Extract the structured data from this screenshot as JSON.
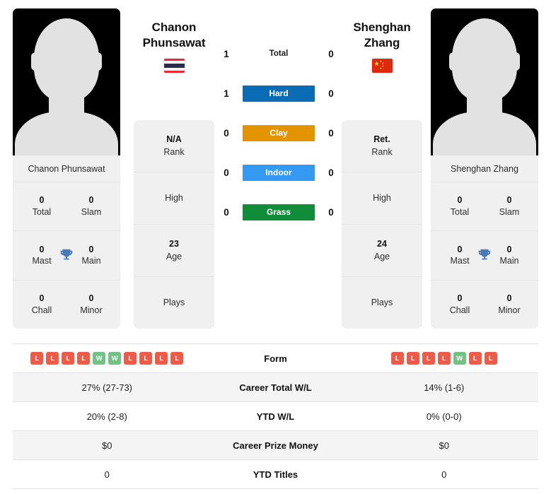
{
  "players": {
    "left": {
      "name_line1": "Chanon",
      "name_line2": "Phunsawat",
      "full_name": "Chanon Phunsawat",
      "flag": "thailand-flag",
      "rank_value": "N/A",
      "rank_label": "Rank",
      "high_label": "High",
      "age_value": "23",
      "age_label": "Age",
      "plays_label": "Plays",
      "titles": [
        {
          "value": "0",
          "label": "Total"
        },
        {
          "value": "0",
          "label": "Slam"
        },
        {
          "value": "0",
          "label": "Mast"
        },
        {
          "value": "0",
          "label": "Main"
        },
        {
          "value": "0",
          "label": "Chall"
        },
        {
          "value": "0",
          "label": "Minor"
        }
      ],
      "form": [
        "L",
        "L",
        "L",
        "L",
        "W",
        "W",
        "L",
        "L",
        "L",
        "L"
      ],
      "career_total_wl": "27% (27-73)",
      "ytd_wl": "20% (2-8)",
      "career_prize_money": "$0",
      "ytd_titles": "0"
    },
    "right": {
      "name_line1": "Shenghan",
      "name_line2": "Zhang",
      "full_name": "Shenghan Zhang",
      "flag": "china-flag",
      "rank_value": "Ret.",
      "rank_label": "Rank",
      "high_label": "High",
      "age_value": "24",
      "age_label": "Age",
      "plays_label": "Plays",
      "titles": [
        {
          "value": "0",
          "label": "Total"
        },
        {
          "value": "0",
          "label": "Slam"
        },
        {
          "value": "0",
          "label": "Mast"
        },
        {
          "value": "0",
          "label": "Main"
        },
        {
          "value": "0",
          "label": "Chall"
        },
        {
          "value": "0",
          "label": "Minor"
        }
      ],
      "form": [
        "L",
        "L",
        "L",
        "L",
        "W",
        "L",
        "L"
      ],
      "career_total_wl": "14% (1-6)",
      "ytd_wl": "0% (0-0)",
      "career_prize_money": "$0",
      "ytd_titles": "0"
    }
  },
  "h2h": {
    "rows": [
      {
        "label": "Total",
        "left": "1",
        "right": "0",
        "color": "",
        "plain": true
      },
      {
        "label": "Hard",
        "left": "1",
        "right": "0",
        "color": "#0a6cb4",
        "plain": false
      },
      {
        "label": "Clay",
        "left": "0",
        "right": "0",
        "color": "#e39400",
        "plain": false
      },
      {
        "label": "Indoor",
        "left": "0",
        "right": "0",
        "color": "#3399f3",
        "plain": false
      },
      {
        "label": "Grass",
        "left": "0",
        "right": "0",
        "color": "#118c38",
        "plain": false
      }
    ]
  },
  "stats_table": {
    "rows": [
      {
        "label": "Form",
        "type": "form",
        "shaded": false
      },
      {
        "label": "Career Total W/L",
        "type": "text",
        "shaded": true,
        "key": "career_total_wl"
      },
      {
        "label": "YTD W/L",
        "type": "text",
        "shaded": false,
        "key": "ytd_wl"
      },
      {
        "label": "Career Prize Money",
        "type": "text",
        "shaded": true,
        "key": "career_prize_money"
      },
      {
        "label": "YTD Titles",
        "type": "text",
        "shaded": false,
        "key": "ytd_titles"
      }
    ]
  },
  "colors": {
    "hard": "#0a6cb4",
    "clay": "#e39400",
    "indoor": "#3399f3",
    "grass": "#118c38",
    "win": "#74c184",
    "loss": "#ef5b48",
    "panel": "#f0f0f0",
    "trophy": "#4a7ab5"
  }
}
